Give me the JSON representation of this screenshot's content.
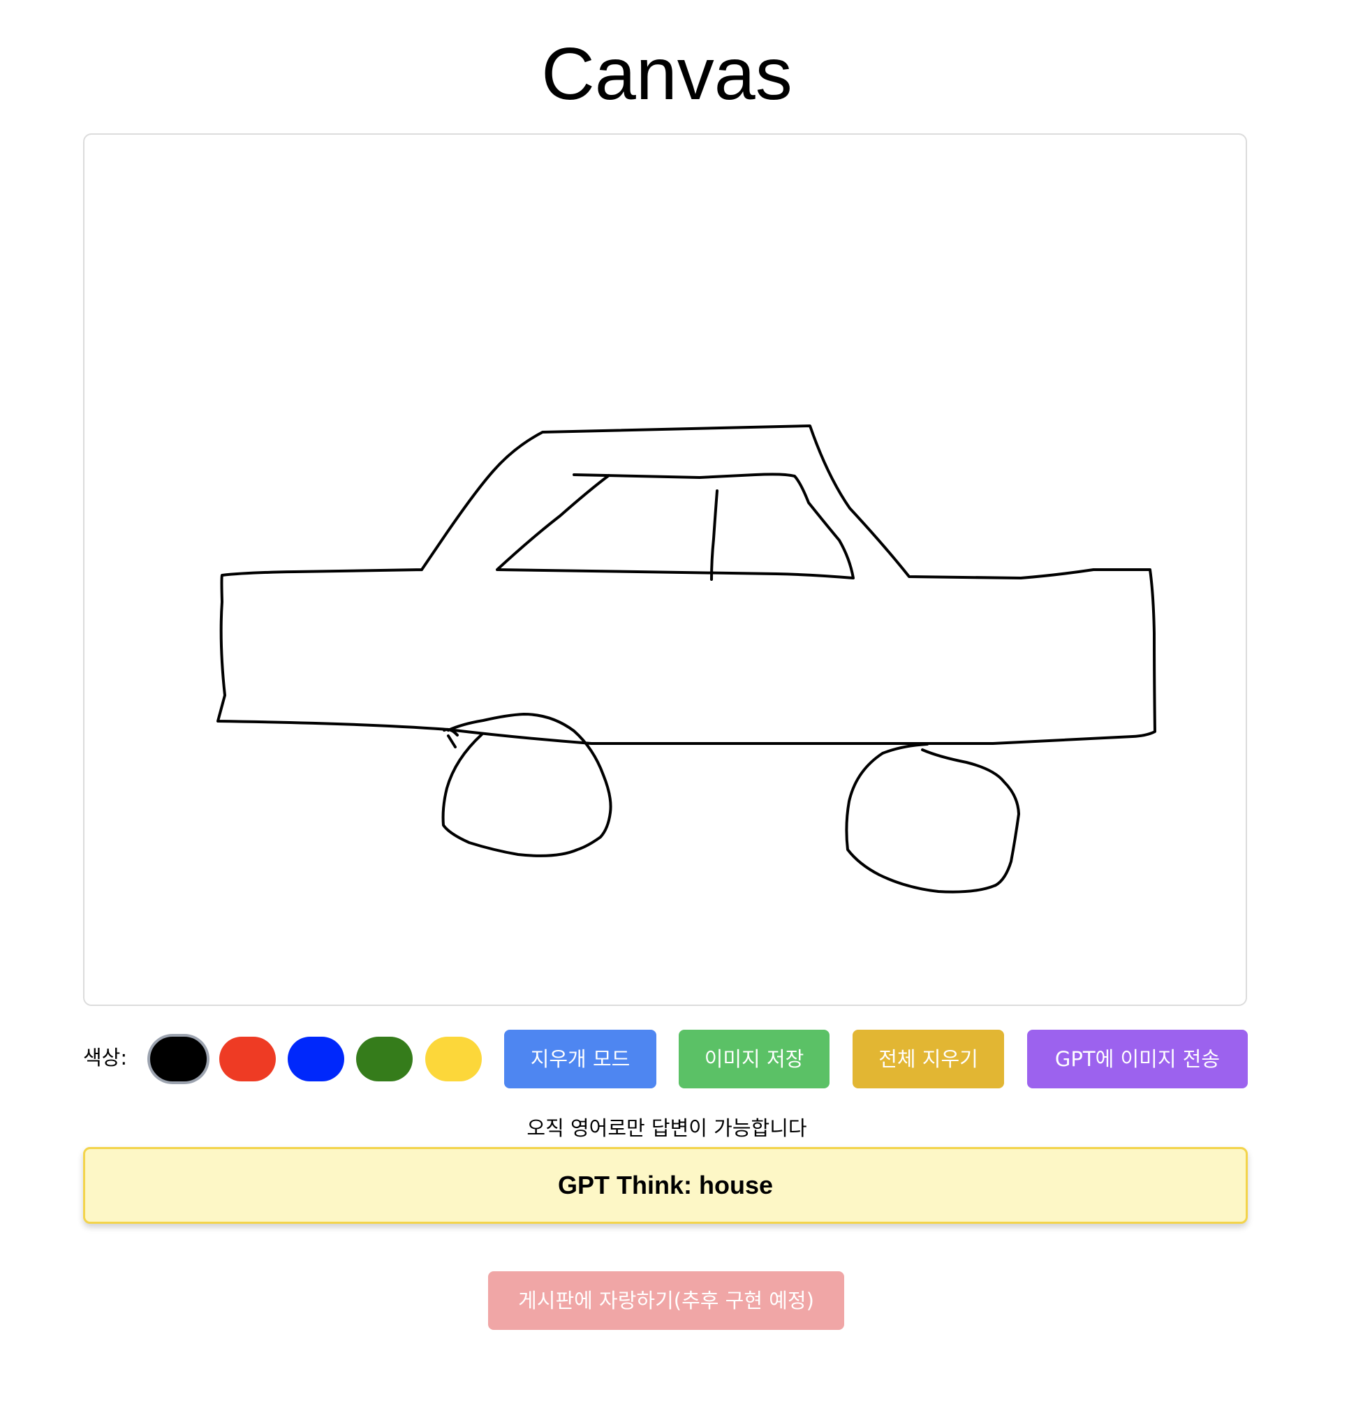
{
  "page": {
    "title": "Canvas"
  },
  "canvas": {
    "drawing_subject": "car",
    "stroke_color": "#000000"
  },
  "toolbar": {
    "color_label": "색상:",
    "colors": [
      {
        "name": "black",
        "hex": "#000000",
        "selected": true
      },
      {
        "name": "red",
        "hex": "#ee3b24"
      },
      {
        "name": "blue",
        "hex": "#0028fb"
      },
      {
        "name": "green",
        "hex": "#357c1b"
      },
      {
        "name": "yellow",
        "hex": "#fcd73a"
      }
    ],
    "eraser_label": "지우개 모드",
    "save_label": "이미지 저장",
    "clear_label": "전체 지우기",
    "send_label": "GPT에 이미지 전송",
    "button_colors": {
      "eraser": "#4e86f1",
      "save": "#5bc166",
      "clear": "#e2b633",
      "send": "#9c62ee"
    }
  },
  "notice": "오직 영어로만 답변이 가능합니다",
  "result": {
    "text": "GPT Think: house"
  },
  "share": {
    "label": "게시판에 자랑하기(추후 구현 예정)",
    "color": "#f0a6a6"
  }
}
